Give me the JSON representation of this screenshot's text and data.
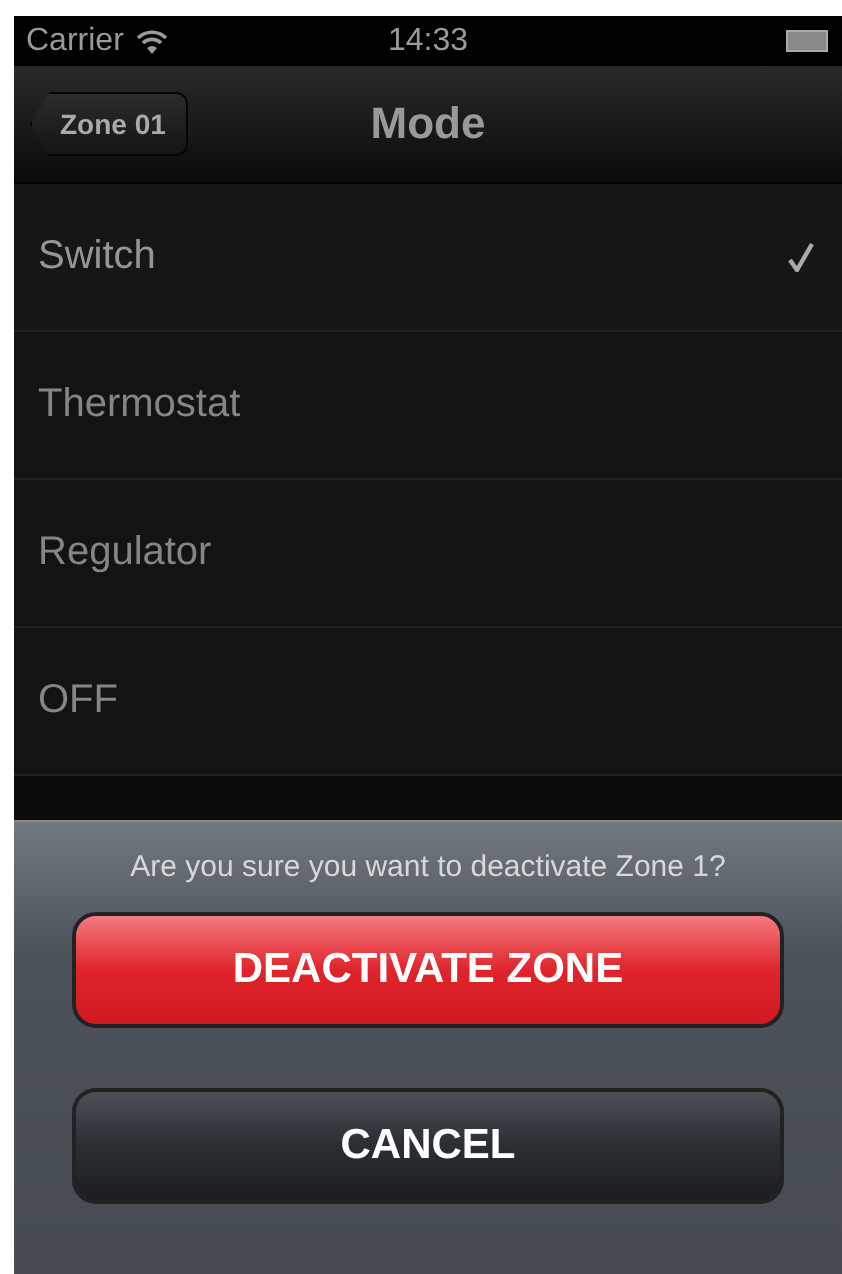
{
  "status_bar": {
    "carrier": "Carrier",
    "time": "14:33"
  },
  "nav_bar": {
    "back": "Zone 01",
    "title": "Mode"
  },
  "modes": [
    {
      "label": "Switch",
      "selected": true
    },
    {
      "label": "Thermostat",
      "selected": false
    },
    {
      "label": "Regulator",
      "selected": false
    },
    {
      "label": "OFF",
      "selected": false
    }
  ],
  "action_sheet": {
    "message": "Are you sure you want to deactivate Zone 1?",
    "buttons": [
      {
        "label": "DEACTIVATE ZONE",
        "kind": "destructive"
      },
      {
        "label": "CANCEL",
        "kind": "cancel"
      }
    ]
  }
}
